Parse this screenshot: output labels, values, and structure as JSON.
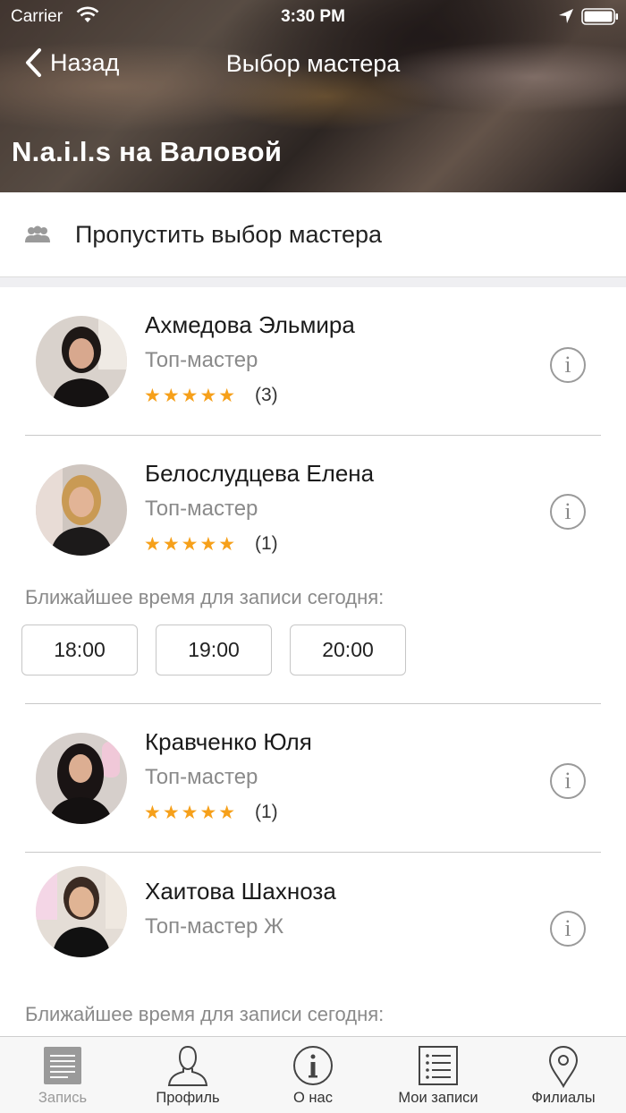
{
  "status": {
    "carrier": "Carrier",
    "time": "3:30 PM"
  },
  "nav": {
    "back_label": "Назад",
    "title": "Выбор мастера"
  },
  "salon": {
    "name": "N.a.i.l.s на Валовой"
  },
  "skip": {
    "label": "Пропустить выбор мастера"
  },
  "masters": [
    {
      "name": "Ахмедова Эльмира",
      "role": "Топ-мастер",
      "stars": "★★★★★",
      "reviews": "(3)"
    },
    {
      "name": "Белослудцева Елена",
      "role": "Топ-мастер",
      "stars": "★★★★★",
      "reviews": "(1)",
      "nearest_label": "Ближайшее время для записи сегодня:",
      "slots": [
        "18:00",
        "19:00",
        "20:00"
      ]
    },
    {
      "name": "Кравченко Юля",
      "role": "Топ-мастер",
      "stars": "★★★★★",
      "reviews": "(1)"
    },
    {
      "name": "Хаитова Шахноза",
      "role": "Топ-мастер Ж",
      "nearest_label": "Ближайшее время для записи сегодня:"
    }
  ],
  "tabs": [
    {
      "label": "Запись",
      "icon": "document-icon",
      "active": true
    },
    {
      "label": "Профиль",
      "icon": "person-icon"
    },
    {
      "label": "О нас",
      "icon": "info-icon"
    },
    {
      "label": "Мои записи",
      "icon": "list-icon"
    },
    {
      "label": "Филиалы",
      "icon": "map-pin-icon"
    }
  ],
  "colors": {
    "star": "#f6a01a",
    "secondary_text": "#8a8a8a",
    "divider": "#c8c8c8"
  }
}
